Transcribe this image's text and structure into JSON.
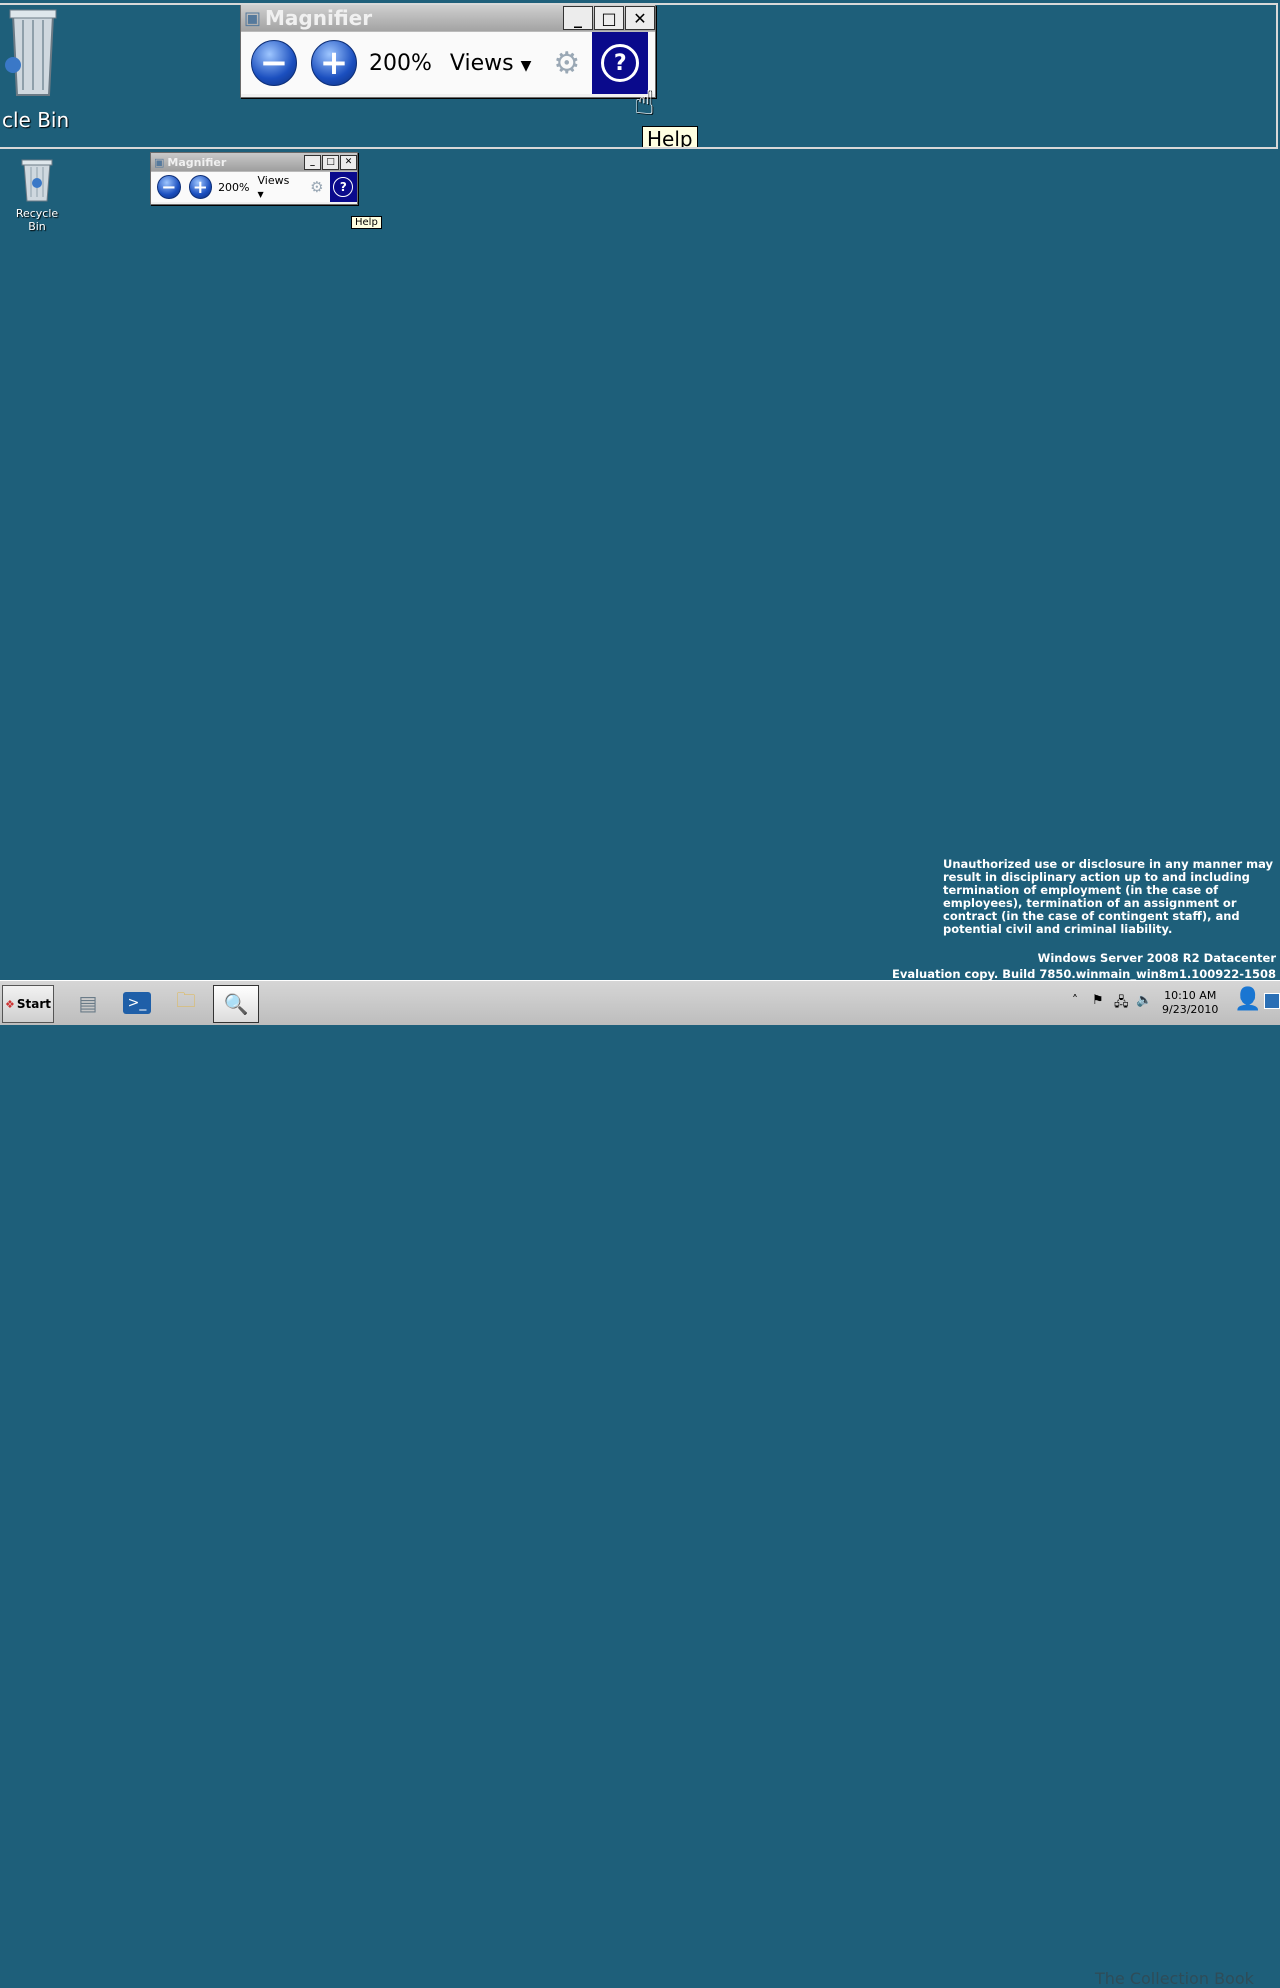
{
  "lens": {
    "recycle_label": "cle Bin",
    "magnifier": {
      "title": "Magnifier",
      "zoom": "200%",
      "views": "Views"
    },
    "tooltip": "Help"
  },
  "desktop": {
    "recycle_bin_label": "Recycle Bin"
  },
  "magnifier": {
    "title": "Magnifier",
    "zoom": "200%",
    "views": "Views",
    "minimize": "_",
    "maximize": "□",
    "close": "✕",
    "tooltip": "Help"
  },
  "notice": "Unauthorized use or disclosure in any manner may result in disciplinary action up to and including termination of employment (in the case of employees), termination of an assignment or contract (in the case of contingent staff), and potential civil and criminal liability.",
  "version": {
    "line1": "Windows Server 2008 R2 Datacenter",
    "line2": "Evaluation copy. Build 7850.winmain_win8m1.100922-1508"
  },
  "taskbar": {
    "start": "Start",
    "time": "10:10 AM",
    "date": "9/23/2010",
    "watermark": "The Collection Book"
  },
  "icons": {
    "minus": "minus-icon",
    "plus": "plus-icon",
    "gear": "gear-icon",
    "help": "help-icon"
  }
}
